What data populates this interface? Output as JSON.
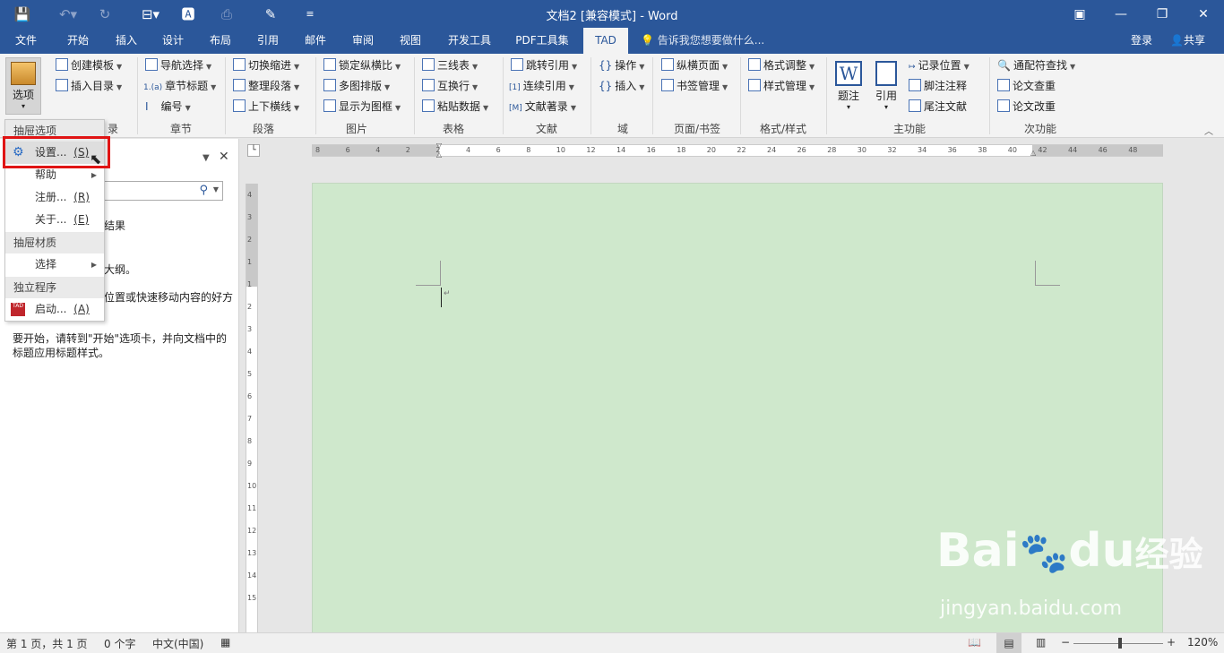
{
  "window": {
    "title": "文档2 [兼容模式] - Word"
  },
  "tabs": [
    "文件",
    "开始",
    "插入",
    "设计",
    "布局",
    "引用",
    "邮件",
    "审阅",
    "视图",
    "开发工具",
    "PDF工具集",
    "TAD"
  ],
  "tell_me": "告诉我您想要做什么...",
  "account": {
    "login": "登录",
    "share": "共享"
  },
  "ribbon": {
    "options_button": "选项",
    "groups": {
      "zhangjie": {
        "label": "章节",
        "items": [
          "导航选择",
          "章节标题",
          "编号"
        ]
      },
      "mulu": {
        "items": [
          "创建模板",
          "插入目录"
        ],
        "label_fragment": "录"
      },
      "duanluo": {
        "label": "段落",
        "items": [
          "切换缩进",
          "整理段落",
          "上下横线"
        ]
      },
      "tupian": {
        "label": "图片",
        "items": [
          "锁定纵横比",
          "多图排版",
          "显示为图框"
        ]
      },
      "biaoge": {
        "label": "表格",
        "items": [
          "三线表",
          "互换行",
          "粘贴数据"
        ]
      },
      "wenxian": {
        "label": "文献",
        "items": [
          "跳转引用",
          "连续引用",
          "文献著录"
        ]
      },
      "yu": {
        "label": "域",
        "items": [
          "操作",
          "插入"
        ]
      },
      "yemian": {
        "label": "页面/书签",
        "items": [
          "纵横页面",
          "书签管理"
        ]
      },
      "geshi": {
        "label": "格式/样式",
        "items": [
          "格式调整",
          "样式管理"
        ]
      },
      "zhugongneng": {
        "label": "主功能",
        "big": [
          "题注",
          "引用"
        ],
        "items": [
          "记录位置",
          "脚注注释",
          "尾注文献"
        ]
      },
      "cigongneng": {
        "label": "次功能",
        "items": [
          "通配符查找",
          "论文查重",
          "论文改重"
        ]
      }
    }
  },
  "menu": {
    "sections": [
      {
        "header": "抽屉选项",
        "items": [
          {
            "label": "设置...",
            "key": "(S)",
            "selected": true
          },
          {
            "label": "帮助",
            "submenu": true
          },
          {
            "label": "注册...",
            "key": "(R)"
          },
          {
            "label": "关于...",
            "key": "(E)"
          }
        ]
      },
      {
        "header": "抽屉材质",
        "items": [
          {
            "label": "选择",
            "submenu": true
          }
        ]
      },
      {
        "header": "独立程序",
        "items": [
          {
            "label": "启动...",
            "key": "(A)"
          }
        ]
      }
    ]
  },
  "navpane": {
    "fragments": [
      "结果",
      "大纲。",
      "位置或快速移动内容的好方"
    ],
    "instructions_line1": "要开始，请转到\"开始\"选项卡，并向文档中的",
    "instructions_line2": "标题应用标题样式。"
  },
  "ruler": {
    "h_ticks": [
      "8",
      "6",
      "4",
      "2",
      "2",
      "4",
      "6",
      "8",
      "10",
      "12",
      "14",
      "16",
      "18",
      "20",
      "22",
      "24",
      "26",
      "28",
      "30",
      "32",
      "34",
      "36",
      "38",
      "40",
      "42",
      "44",
      "46",
      "48"
    ],
    "v_ticks": [
      "4",
      "3",
      "2",
      "1",
      "1",
      "2",
      "3",
      "4",
      "5",
      "6",
      "7",
      "8",
      "9",
      "10",
      "11",
      "12",
      "13",
      "14",
      "15"
    ]
  },
  "status": {
    "page": "第 1 页，共 1 页",
    "words": "0 个字",
    "language": "中文(中国)",
    "zoom": "120%"
  },
  "watermark": {
    "brand": "Bai",
    "brand2": "du",
    "text": "经验",
    "url": "jingyan.baidu.com"
  },
  "colors": {
    "title_bar": "#2b579a",
    "page_bg": "#cfe8cc",
    "highlight": "#e01414"
  }
}
